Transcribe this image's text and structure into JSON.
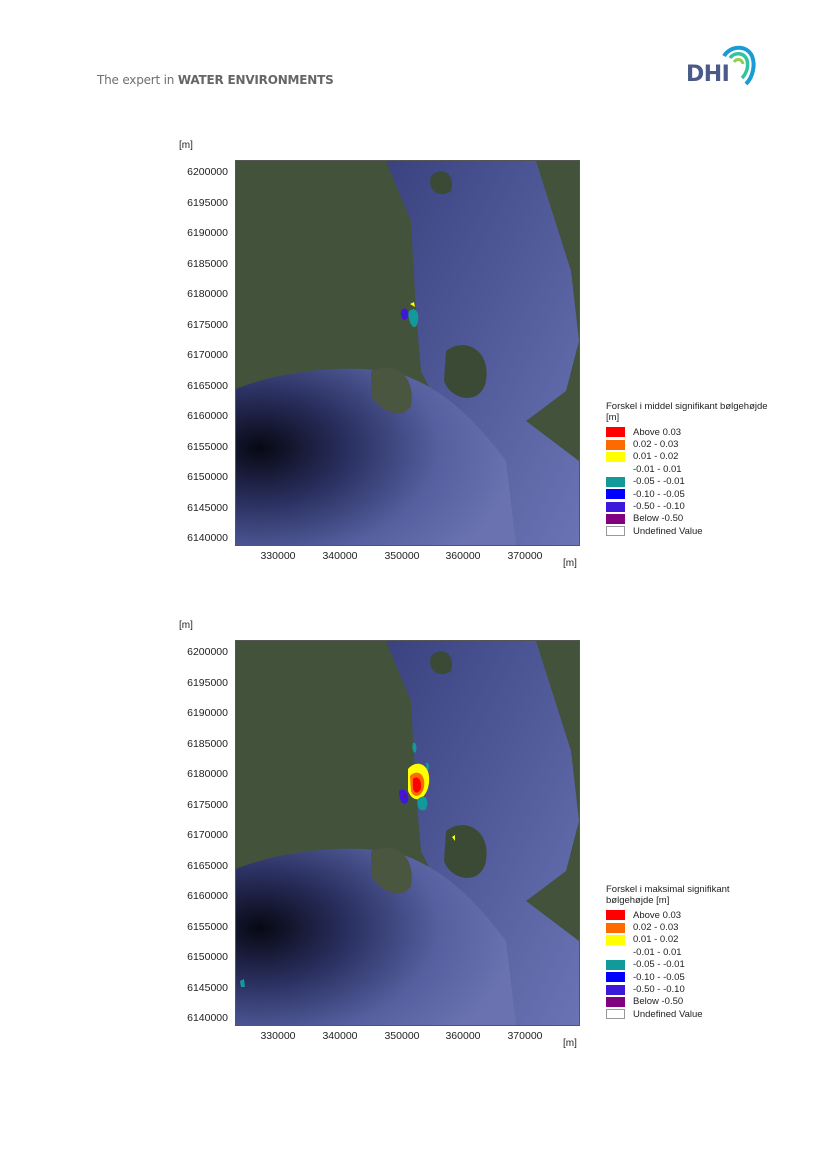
{
  "header": {
    "tagline_prefix": "The expert in ",
    "tagline_bold": "WATER ENVIRONMENTS",
    "logo_text": "DHI"
  },
  "figures": [
    {
      "y_unit": "[m]",
      "x_unit": "[m]",
      "y_ticks": [
        "6200000",
        "6195000",
        "6190000",
        "6185000",
        "6180000",
        "6175000",
        "6170000",
        "6165000",
        "6160000",
        "6155000",
        "6150000",
        "6145000",
        "6140000"
      ],
      "x_ticks": [
        "330000",
        "340000",
        "350000",
        "360000",
        "370000"
      ],
      "legend_title": "Forskel i middel signifikant bølgehøjde [m]",
      "legend": [
        {
          "label": "Above  0.03",
          "color": "#ff0000"
        },
        {
          "label": " 0.02 -  0.03",
          "color": "#ff6a00"
        },
        {
          "label": " 0.01 -  0.02",
          "color": "#ffff00"
        },
        {
          "label": "-0.01 -  0.01",
          "color": "#ffffff"
        },
        {
          "label": "-0.05 - -0.01",
          "color": "#129a9a"
        },
        {
          "label": "-0.10 - -0.05",
          "color": "#0000ff"
        },
        {
          "label": "-0.50 - -0.10",
          "color": "#3e18d8"
        },
        {
          "label": "Below -0.50",
          "color": "#800080"
        },
        {
          "label": "Undefined Value",
          "color": "#ffffff"
        }
      ]
    },
    {
      "y_unit": "[m]",
      "x_unit": "[m]",
      "y_ticks": [
        "6200000",
        "6195000",
        "6190000",
        "6185000",
        "6180000",
        "6175000",
        "6170000",
        "6165000",
        "6160000",
        "6155000",
        "6150000",
        "6145000",
        "6140000"
      ],
      "x_ticks": [
        "330000",
        "340000",
        "350000",
        "360000",
        "370000"
      ],
      "legend_title": "Forskel i maksimal signifikant bølgehøjde [m]",
      "legend": [
        {
          "label": "Above  0.03",
          "color": "#ff0000"
        },
        {
          "label": " 0.02 -  0.03",
          "color": "#ff6a00"
        },
        {
          "label": " 0.01 -  0.02",
          "color": "#ffff00"
        },
        {
          "label": "-0.01 -  0.01",
          "color": "#ffffff"
        },
        {
          "label": "-0.05 - -0.01",
          "color": "#129a9a"
        },
        {
          "label": "-0.10 - -0.05",
          "color": "#0000ff"
        },
        {
          "label": "-0.50 - -0.10",
          "color": "#3e18d8"
        },
        {
          "label": "Below -0.50",
          "color": "#800080"
        },
        {
          "label": "Undefined Value",
          "color": "#ffffff"
        }
      ]
    }
  ]
}
